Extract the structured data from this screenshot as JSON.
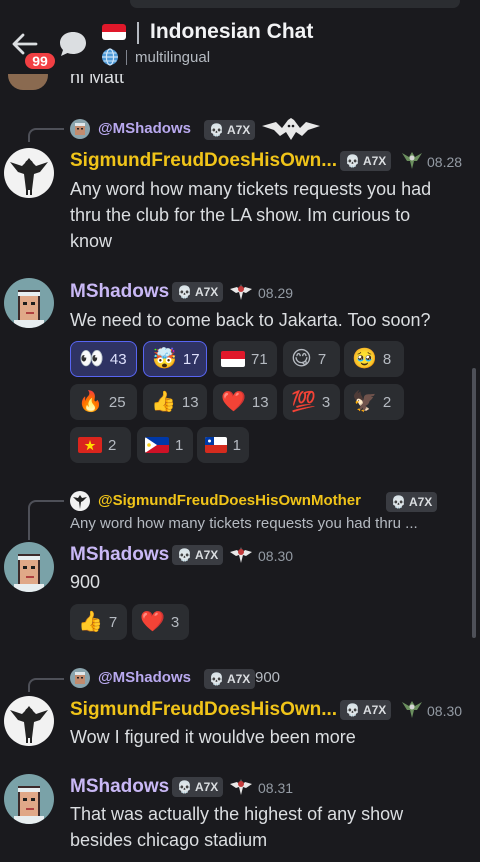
{
  "header": {
    "title": "Indonesian Chat",
    "subtitle": "multilingual",
    "badge_count": "99"
  },
  "prev_message_fragment": "hi Matt",
  "messages": [
    {
      "reply_to": {
        "name": "@MShadows",
        "tag": "A7X",
        "text": ""
      },
      "author": "SigmundFreudDoesHisOwn...",
      "tag": "A7X",
      "time": "08.28",
      "lines": [
        "Any word how many tickets requests you had",
        "thru the club for the LA show. Im curious to",
        "know"
      ]
    },
    {
      "author": "MShadows",
      "tag": "A7X",
      "time": "08.29",
      "lines": [
        "We need to come back to Jakarta.  Too soon?"
      ],
      "reactions": [
        {
          "emoji": "👀",
          "count": "43",
          "selected": true
        },
        {
          "emoji": "🤯",
          "count": "17",
          "selected": true
        },
        {
          "emoji": "flag-indonesia",
          "count": "71",
          "selected": false
        },
        {
          "emoji": "😋",
          "count": "7",
          "selected": false
        },
        {
          "emoji": "🥹",
          "count": "8",
          "selected": false
        },
        {
          "emoji": "🔥",
          "count": "25",
          "selected": false
        },
        {
          "emoji": "👍",
          "count": "13",
          "selected": false
        },
        {
          "emoji": "❤️",
          "count": "13",
          "selected": false
        },
        {
          "emoji": "💯",
          "count": "3",
          "selected": false
        },
        {
          "emoji": "🦅",
          "count": "2",
          "selected": false
        },
        {
          "emoji": "flag-vietnam",
          "count": "2",
          "selected": false
        },
        {
          "emoji": "flag-philippines",
          "count": "1",
          "selected": false
        },
        {
          "emoji": "flag-chile",
          "count": "1",
          "selected": false
        }
      ]
    },
    {
      "reply_to": {
        "name": "@SigmundFreudDoesHisOwnMother",
        "tag": "A7X",
        "text": "Any word how many tickets requests you had thru ..."
      },
      "author": "MShadows",
      "tag": "A7X",
      "time": "08.30",
      "lines": [
        "900"
      ],
      "reactions": [
        {
          "emoji": "👍",
          "count": "7"
        },
        {
          "emoji": "❤️",
          "count": "3"
        }
      ]
    },
    {
      "reply_to": {
        "name": "@MShadows",
        "tag": "A7X",
        "text": "900"
      },
      "author": "SigmundFreudDoesHisOwn...",
      "tag": "A7X",
      "time": "08.30",
      "lines": [
        "Wow I figured it wouldve been more"
      ]
    },
    {
      "author": "MShadows",
      "tag": "A7X",
      "time": "08.31",
      "lines": [
        "That was actually the highest of any show",
        "besides chicago stadium"
      ]
    }
  ],
  "colors": {
    "background": "#1a1a1e",
    "username_yellow": "#f0c419",
    "username_purple": "#c9b8f5",
    "reaction_selected_border": "#5865f2",
    "badge_red": "#f23f43"
  }
}
